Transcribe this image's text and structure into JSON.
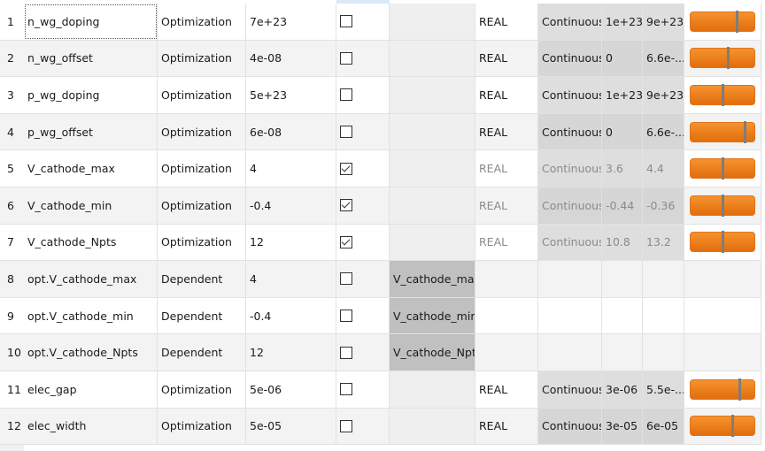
{
  "rows": [
    {
      "n": "1",
      "name": "n_wg_doping",
      "type": "Optimization",
      "value": "7e+23",
      "checked": false,
      "expr": "",
      "dtype": "REAL",
      "kind": "Continuous",
      "min": "1e+23",
      "max": "9e+23",
      "slider": 0.75,
      "disabled": false
    },
    {
      "n": "2",
      "name": "n_wg_offset",
      "type": "Optimization",
      "value": "4e-08",
      "checked": false,
      "expr": "",
      "dtype": "REAL",
      "kind": "Continuous",
      "min": "0",
      "max": "6.6e-...",
      "slider": 0.6,
      "disabled": false
    },
    {
      "n": "3",
      "name": "p_wg_doping",
      "type": "Optimization",
      "value": "5e+23",
      "checked": false,
      "expr": "",
      "dtype": "REAL",
      "kind": "Continuous",
      "min": "1e+23",
      "max": "9e+23",
      "slider": 0.5,
      "disabled": false
    },
    {
      "n": "4",
      "name": "p_wg_offset",
      "type": "Optimization",
      "value": "6e-08",
      "checked": false,
      "expr": "",
      "dtype": "REAL",
      "kind": "Continuous",
      "min": "0",
      "max": "6.6e-...",
      "slider": 0.91,
      "disabled": false
    },
    {
      "n": "5",
      "name": "V_cathode_max",
      "type": "Optimization",
      "value": "4",
      "checked": true,
      "expr": "",
      "dtype": "REAL",
      "kind": "Continuous",
      "min": "3.6",
      "max": "4.4",
      "slider": 0.5,
      "disabled": true
    },
    {
      "n": "6",
      "name": "V_cathode_min",
      "type": "Optimization",
      "value": "-0.4",
      "checked": true,
      "expr": "",
      "dtype": "REAL",
      "kind": "Continuous",
      "min": "-0.44",
      "max": "-0.36",
      "slider": 0.5,
      "disabled": true
    },
    {
      "n": "7",
      "name": "V_cathode_Npts",
      "type": "Optimization",
      "value": "12",
      "checked": true,
      "expr": "",
      "dtype": "REAL",
      "kind": "Continuous",
      "min": "10.8",
      "max": "13.2",
      "slider": 0.5,
      "disabled": true
    },
    {
      "n": "8",
      "name": "opt.V_cathode_max",
      "type": "Dependent",
      "value": "4",
      "checked": false,
      "expr": "V_cathode_max",
      "dtype": "",
      "kind": "",
      "min": "",
      "max": "",
      "slider": null,
      "disabled": false
    },
    {
      "n": "9",
      "name": "opt.V_cathode_min",
      "type": "Dependent",
      "value": "-0.4",
      "checked": false,
      "expr": "V_cathode_min",
      "dtype": "",
      "kind": "",
      "min": "",
      "max": "",
      "slider": null,
      "disabled": false
    },
    {
      "n": "10",
      "name": "opt.V_cathode_Npts",
      "type": "Dependent",
      "value": "12",
      "checked": false,
      "expr": "V_cathode_Npts",
      "dtype": "",
      "kind": "",
      "min": "",
      "max": "",
      "slider": null,
      "disabled": false
    },
    {
      "n": "11",
      "name": "elec_gap",
      "type": "Optimization",
      "value": "5e-06",
      "checked": false,
      "expr": "",
      "dtype": "REAL",
      "kind": "Continuous",
      "min": "3e-06",
      "max": "5.5e-...",
      "slider": 0.8,
      "disabled": false
    },
    {
      "n": "12",
      "name": "elec_width",
      "type": "Optimization",
      "value": "5e-05",
      "checked": false,
      "expr": "",
      "dtype": "REAL",
      "kind": "Continuous",
      "min": "3e-05",
      "max": "6e-05",
      "slider": 0.67,
      "disabled": false
    }
  ],
  "colors": {
    "slider": "#f08020",
    "thumb": "#7d7d7d",
    "dependent_expr": "#c0c0c0"
  }
}
